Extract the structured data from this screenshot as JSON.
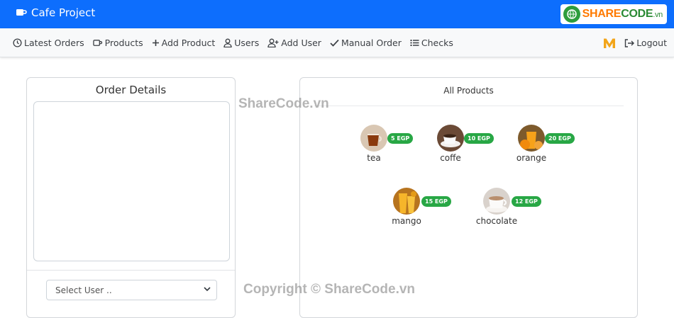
{
  "app": {
    "title": "Cafe Project"
  },
  "logo": {
    "share": "SHARE",
    "code": "CODE",
    "vn": ".vn"
  },
  "nav": {
    "items": [
      {
        "label": "Latest Orders",
        "icon": "clock-icon"
      },
      {
        "label": "Products",
        "icon": "cup-icon"
      },
      {
        "label": "Add Product",
        "icon": "plus-icon"
      },
      {
        "label": "Users",
        "icon": "user-icon"
      },
      {
        "label": "Add User",
        "icon": "user-plus-icon"
      },
      {
        "label": "Manual Order",
        "icon": "check-icon"
      },
      {
        "label": "Checks",
        "icon": "list-icon"
      }
    ],
    "logout": "Logout"
  },
  "order": {
    "title": "Order Details",
    "user_select": "Select User .."
  },
  "products": {
    "title": "All Products",
    "items": [
      {
        "name": "tea",
        "price": "5 EGP",
        "color": "#7a3b10"
      },
      {
        "name": "coffe",
        "price": "10 EGP",
        "color": "#3e2a1e"
      },
      {
        "name": "orange",
        "price": "20 EGP",
        "color": "#f59a1b"
      },
      {
        "name": "mango",
        "price": "15 EGP",
        "color": "#f5b21b"
      },
      {
        "name": "chocolate",
        "price": "12 EGP",
        "color": "#c9b6a6"
      }
    ]
  },
  "watermarks": {
    "top": "ShareCode.vn",
    "bottom": "Copyright © ShareCode.vn"
  },
  "colors": {
    "primary": "#0d6efd",
    "price_badge": "#28a745"
  }
}
